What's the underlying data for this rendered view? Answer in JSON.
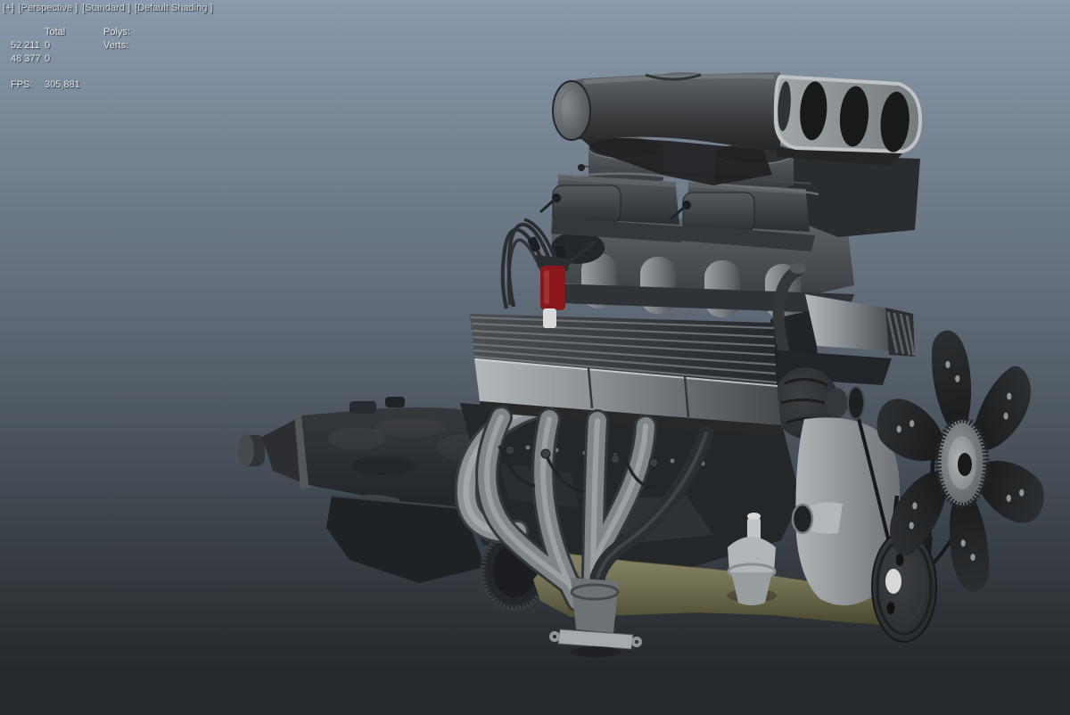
{
  "viewport": {
    "label_segments": [
      {
        "label": "[+]"
      },
      {
        "label": "[Perspective ]"
      },
      {
        "label": "[Standard ]"
      },
      {
        "label": "[Default Shading ]"
      }
    ],
    "stats": {
      "col_header": "Total",
      "rows": [
        {
          "name": "Polys:",
          "total": "52 211",
          "selected": "0"
        },
        {
          "name": "Verts:",
          "total": "48 377",
          "selected": "0"
        }
      ],
      "fps_label": "FPS:",
      "fps_value": "305,881"
    }
  },
  "scene": {
    "colors": {
      "bg_top": "#8a9aac",
      "bg_mid": "#5c6773",
      "bg_bottom": "#25282c",
      "oil_pan": "#67643e",
      "ignition_coil": "#8a171b",
      "metal_light": "#b9bdbf",
      "metal_mid": "#7f8487",
      "metal_dark": "#2b2e30",
      "fan_blade": "#212426"
    }
  }
}
